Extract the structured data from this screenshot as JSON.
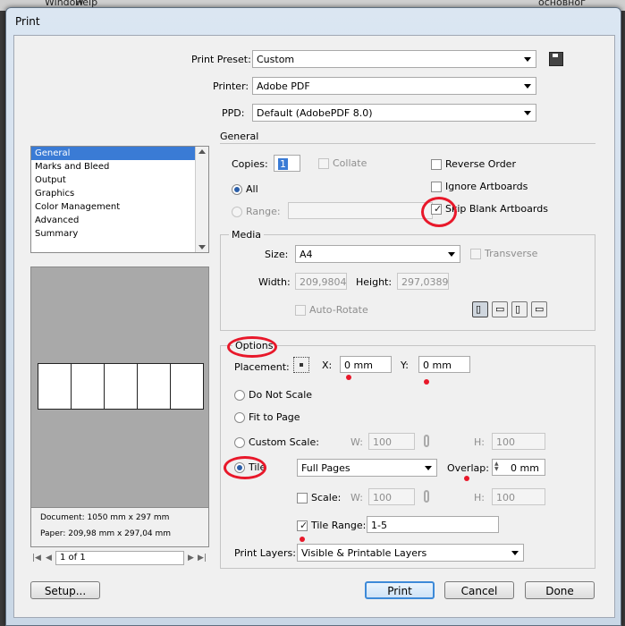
{
  "background_menu": {
    "window": "Window",
    "help": "Help",
    "workspace": "основног"
  },
  "title": "Print",
  "print_preset": {
    "label": "Print Preset:",
    "value": "Custom"
  },
  "printer": {
    "label": "Printer:",
    "value": "Adobe PDF"
  },
  "ppd": {
    "label": "PPD:",
    "value": "Default (AdobePDF 8.0)"
  },
  "sidebar": {
    "items": [
      {
        "label": "General"
      },
      {
        "label": "Marks and Bleed"
      },
      {
        "label": "Output"
      },
      {
        "label": "Graphics"
      },
      {
        "label": "Color Management"
      },
      {
        "label": "Advanced"
      },
      {
        "label": "Summary"
      }
    ],
    "selected": "General"
  },
  "preview": {
    "document": "Document: 1050 mm x 297 mm",
    "paper": "Paper: 209,98 mm x 297,04 mm",
    "page_nav": "1 of 1"
  },
  "general": {
    "heading": "General",
    "copies_label": "Copies:",
    "copies_value": "1",
    "collate": "Collate",
    "all": "All",
    "range": "Range:",
    "reverse_order": "Reverse Order",
    "ignore_artboards": "Ignore Artboards",
    "skip_blank": "Skip Blank Artboards"
  },
  "media": {
    "heading": "Media",
    "size_label": "Size:",
    "size_value": "A4",
    "transverse": "Transverse",
    "width_label": "Width:",
    "width_value": "209,9804",
    "height_label": "Height:",
    "height_value": "297,0389",
    "auto_rotate": "Auto-Rotate"
  },
  "options": {
    "heading": "Options",
    "placement_label": "Placement:",
    "x_label": "X:",
    "x_value": "0 mm",
    "y_label": "Y:",
    "y_value": "0 mm",
    "do_not_scale": "Do Not Scale",
    "fit_to_page": "Fit to Page",
    "custom_scale": "Custom Scale:",
    "w_label": "W:",
    "w_value": "100",
    "h_label": "H:",
    "h_value": "100",
    "tile": "Tile",
    "tile_mode": "Full Pages",
    "overlap_label": "Overlap:",
    "overlap_value": "0 mm",
    "scale": "Scale:",
    "scale_w_value": "100",
    "scale_h_value": "100",
    "tile_range_label": "Tile Range:",
    "tile_range_value": "1-5",
    "print_layers_label": "Print Layers:",
    "print_layers_value": "Visible & Printable Layers"
  },
  "buttons": {
    "setup": "Setup...",
    "print": "Print",
    "cancel": "Cancel",
    "done": "Done"
  },
  "colors": {
    "selection": "#3a7bd5",
    "annotation": "#e8182a",
    "default_button": "#3d8ad8"
  }
}
